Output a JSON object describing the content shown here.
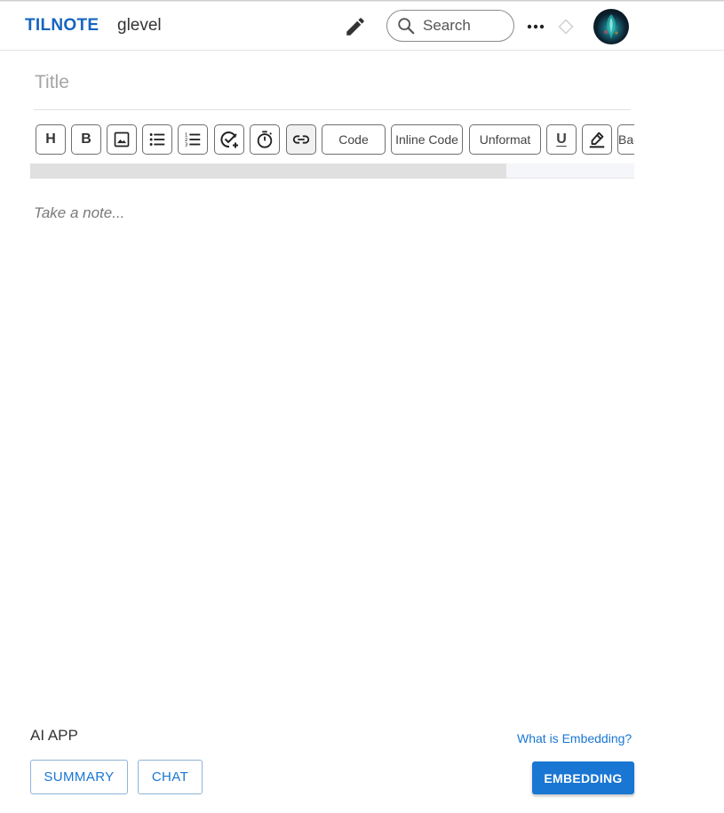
{
  "header": {
    "brand": "TILNOTE",
    "username": "glevel",
    "search_placeholder": "Search",
    "icons": [
      "pencil-icon",
      "search-icon",
      "more-horizontal-icon",
      "diamond-icon"
    ]
  },
  "editor": {
    "title_placeholder": "Title",
    "note_placeholder": "Take a note...",
    "toolbar": {
      "heading_label": "H",
      "bold_label": "B",
      "code_label": "Code",
      "inline_code_label": "Inline Code",
      "unformat_label": "Unformat",
      "underline_label": "U",
      "background_label": "Background",
      "icon_buttons": [
        "image-icon",
        "bullet-list-icon",
        "numbered-list-icon",
        "add-task-icon",
        "timer-icon",
        "link-icon",
        "highlighter-icon"
      ]
    }
  },
  "ai_app": {
    "label": "AI APP",
    "summary_label": "SUMMARY",
    "chat_label": "CHAT",
    "embedding_link": "What is Embedding?",
    "embedding_label": "EMBEDDING"
  },
  "colors": {
    "brand": "#1565c0",
    "primary": "#1976d2"
  }
}
